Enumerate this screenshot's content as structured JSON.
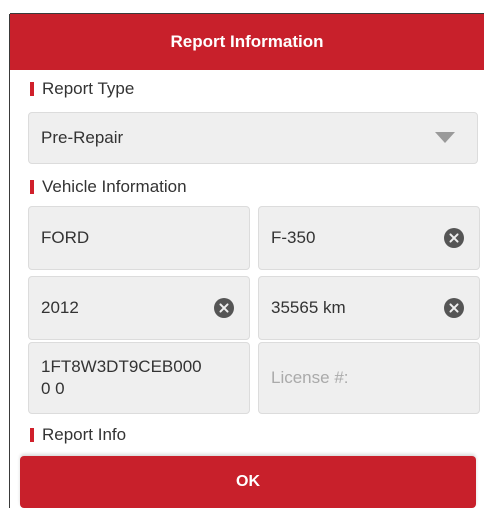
{
  "dialog": {
    "title": "Report Information",
    "ok_label": "OK"
  },
  "report_type": {
    "label": "Report Type",
    "selected": "Pre-Repair"
  },
  "vehicle": {
    "label": "Vehicle Information",
    "make": "FORD",
    "model": "F-350",
    "year": "2012",
    "mileage": "35565 km",
    "vin": "1FT8W3DT9CEB0000 0",
    "license_placeholder": "License #:"
  },
  "report_info": {
    "label": "Report Info"
  },
  "colors": {
    "accent": "#c8202b",
    "field_bg": "#efefef"
  }
}
